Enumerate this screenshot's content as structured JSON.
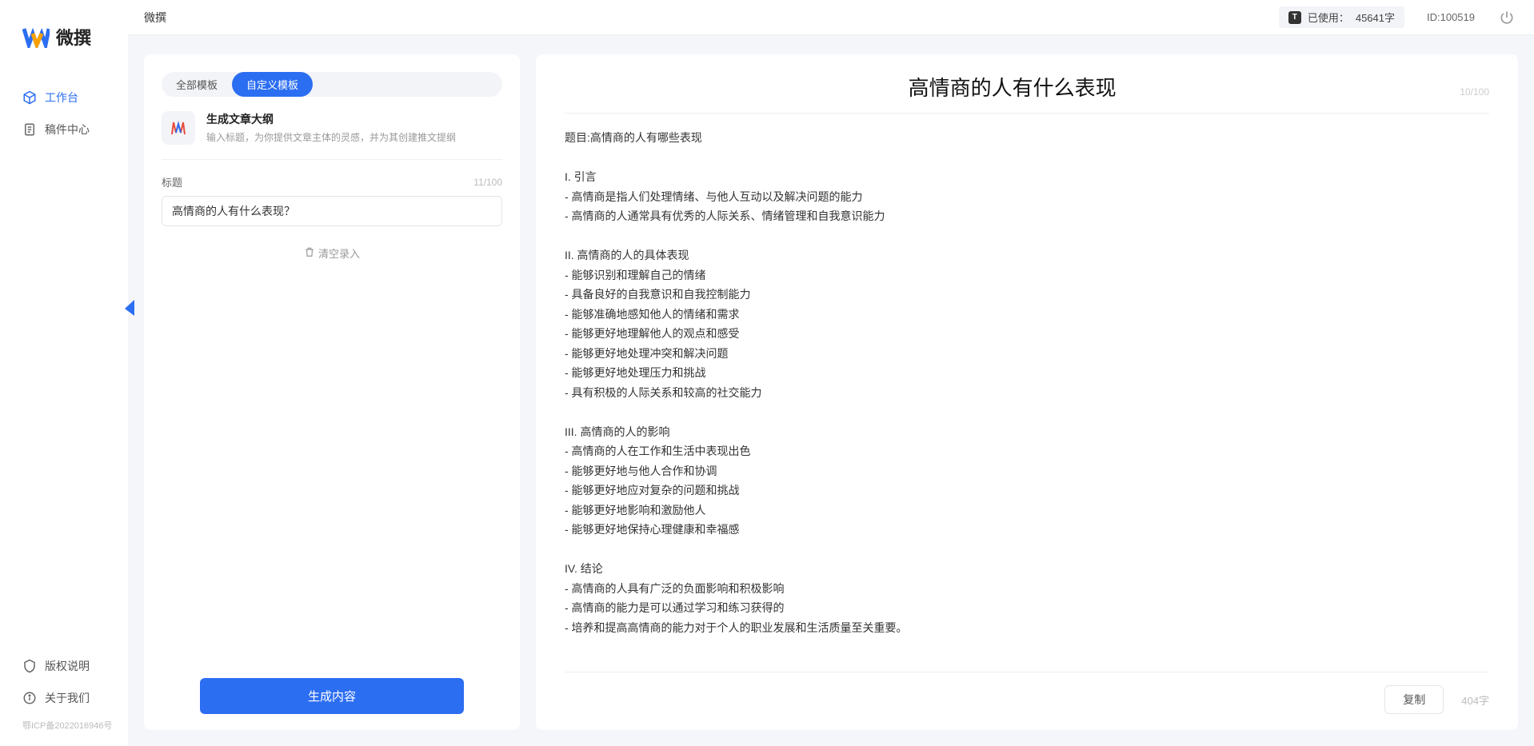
{
  "brand": "微撰",
  "topbar": {
    "title": "微撰",
    "usage_label": "已使用：",
    "usage_value": "45641字",
    "usage_badge": "T",
    "user_id_label": "ID:100519"
  },
  "sidebar": {
    "nav": [
      {
        "label": "工作台",
        "icon": "cube-icon",
        "active": true
      },
      {
        "label": "稿件中心",
        "icon": "docs-icon",
        "active": false
      }
    ],
    "bottom": [
      {
        "label": "版权说明",
        "icon": "shield-icon"
      },
      {
        "label": "关于我们",
        "icon": "info-icon"
      }
    ],
    "icp": "鄂ICP备2022016946号"
  },
  "left_panel": {
    "tabs": [
      {
        "label": "全部模板",
        "active": false
      },
      {
        "label": "自定义模板",
        "active": true
      }
    ],
    "template": {
      "title": "生成文章大纲",
      "desc": "输入标题，为你提供文章主体的灵感，并为其创建推文提纲"
    },
    "title_field": {
      "label": "标题",
      "counter": "11/100",
      "value": "高情商的人有什么表现？"
    },
    "clear_label": "清空录入",
    "generate_label": "生成内容"
  },
  "right_panel": {
    "title": "高情商的人有什么表现",
    "title_counter": "10/100",
    "copy_label": "复制",
    "word_count": "404字",
    "body": "题目:高情商的人有哪些表现\n\nI. 引言\n- 高情商是指人们处理情绪、与他人互动以及解决问题的能力\n- 高情商的人通常具有优秀的人际关系、情绪管理和自我意识能力\n\nII. 高情商的人的具体表现\n- 能够识别和理解自己的情绪\n- 具备良好的自我意识和自我控制能力\n- 能够准确地感知他人的情绪和需求\n- 能够更好地理解他人的观点和感受\n- 能够更好地处理冲突和解决问题\n- 能够更好地处理压力和挑战\n- 具有积极的人际关系和较高的社交能力\n\nIII. 高情商的人的影响\n- 高情商的人在工作和生活中表现出色\n- 能够更好地与他人合作和协调\n- 能够更好地应对复杂的问题和挑战\n- 能够更好地影响和激励他人\n- 能够更好地保持心理健康和幸福感\n\nIV. 结论\n- 高情商的人具有广泛的负面影响和积极影响\n- 高情商的能力是可以通过学习和练习获得的\n- 培养和提高高情商的能力对于个人的职业发展和生活质量至关重要。"
  }
}
